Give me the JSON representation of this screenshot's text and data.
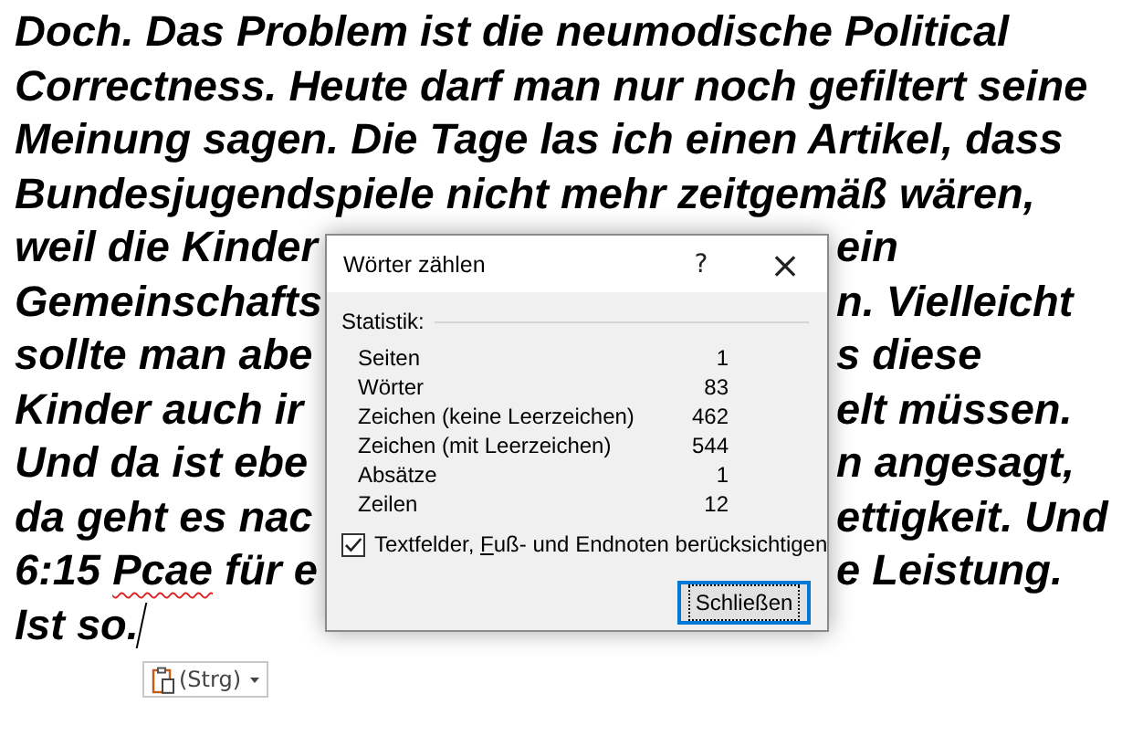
{
  "document": {
    "lines": [
      {
        "parts": [
          {
            "text": "Doch. Das Problem ist die neumodische Political"
          }
        ]
      },
      {
        "parts": [
          {
            "text": "Correctness. Heute darf man nur noch gefiltert seine"
          }
        ]
      },
      {
        "parts": [
          {
            "text": "Meinung sagen. Die Tage las ich einen Artikel, dass"
          }
        ]
      },
      {
        "parts": [
          {
            "text": "Bundesjugendspiele nicht mehr zeitgemäß wären,"
          }
        ]
      },
      {
        "parts": [
          {
            "text": "weil die Kinder"
          }
        ],
        "right": "ein"
      },
      {
        "parts": [
          {
            "text": "Gemeinschafts"
          }
        ],
        "right": "n. Vielleicht"
      },
      {
        "parts": [
          {
            "text": "sollte man abe"
          }
        ],
        "right": "s diese"
      },
      {
        "parts": [
          {
            "text": "Kinder auch ir"
          }
        ],
        "right": "elt müssen."
      },
      {
        "parts": [
          {
            "text": "Und da ist ebe"
          }
        ],
        "right": "n angesagt,"
      },
      {
        "parts": [
          {
            "text": "da geht es nac"
          }
        ],
        "right": "ettigkeit. Und"
      },
      {
        "parts": [
          {
            "text": "6:15 "
          },
          {
            "text": "Pcae",
            "misspelled": true
          },
          {
            "text": " für e"
          }
        ],
        "right": "e Leistung."
      },
      {
        "parts": [
          {
            "text": "Ist so."
          }
        ]
      }
    ]
  },
  "paste_options": {
    "label": "(Strg)"
  },
  "dialog": {
    "title": "Wörter zählen",
    "help": "?",
    "close": "×",
    "group_label": "Statistik:",
    "stats": [
      {
        "label": "Seiten",
        "value": "1"
      },
      {
        "label": "Wörter",
        "value": "83"
      },
      {
        "label": "Zeichen (keine Leerzeichen)",
        "value": "462"
      },
      {
        "label": "Zeichen (mit Leerzeichen)",
        "value": "544"
      },
      {
        "label": "Absätze",
        "value": "1"
      },
      {
        "label": "Zeilen",
        "value": "12"
      }
    ],
    "checkbox": {
      "checked": true,
      "label_parts": [
        {
          "text": "Textfelder, ",
          "underline": false
        },
        {
          "text": "F",
          "underline": true
        },
        {
          "text": "uß- und Endnoten berücksichtigen",
          "underline": false
        }
      ]
    },
    "button": {
      "label": "Schließen",
      "focused": true
    }
  }
}
